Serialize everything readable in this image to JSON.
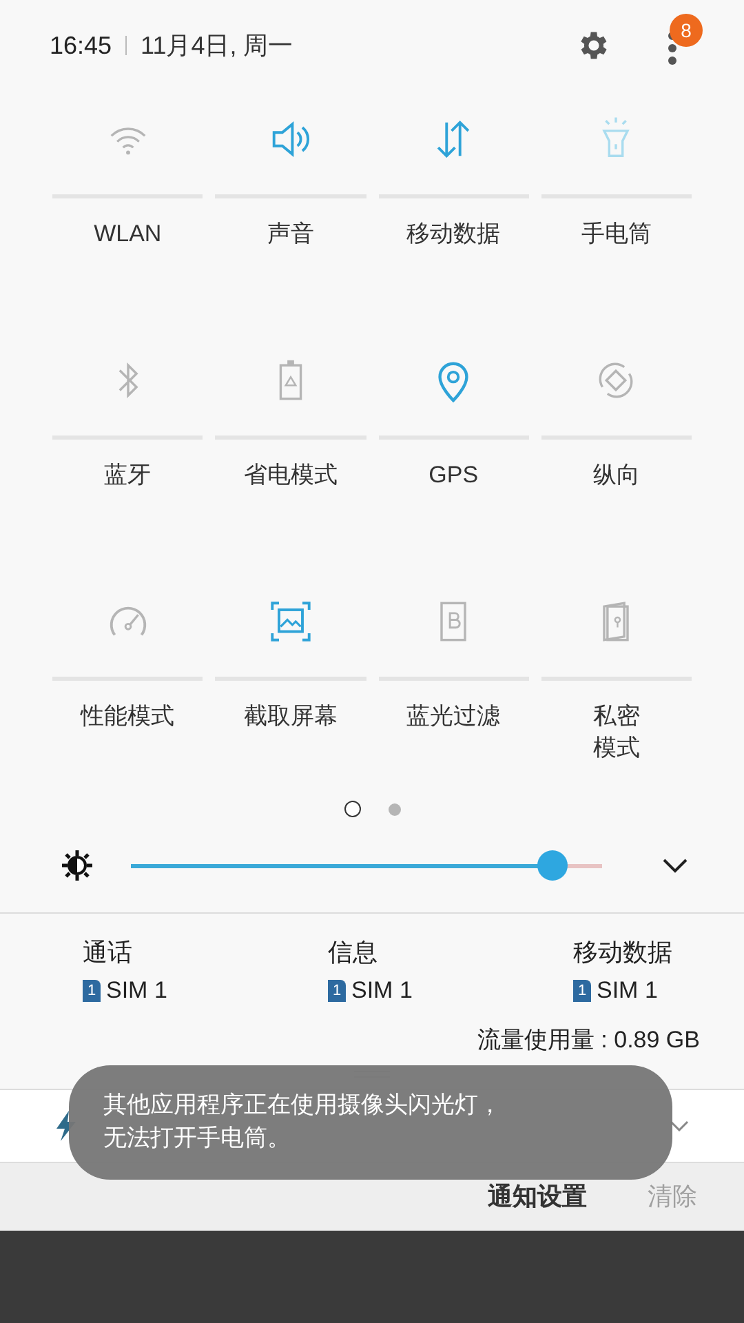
{
  "header": {
    "time": "16:45",
    "date": "11月4日, 周一",
    "badge": "8"
  },
  "tiles": [
    {
      "lines": [
        "WLAN"
      ],
      "on": false,
      "disabled": false
    },
    {
      "lines": [
        "声音"
      ],
      "on": true,
      "disabled": false
    },
    {
      "lines": [
        "移动数据"
      ],
      "on": true,
      "disabled": false
    },
    {
      "lines": [
        "手电筒"
      ],
      "on": true,
      "disabled": true
    },
    {
      "lines": [
        "蓝牙"
      ],
      "on": false,
      "disabled": false
    },
    {
      "lines": [
        "省电模式"
      ],
      "on": false,
      "disabled": false
    },
    {
      "lines": [
        "GPS"
      ],
      "on": true,
      "disabled": false
    },
    {
      "lines": [
        "纵向"
      ],
      "on": false,
      "disabled": false
    },
    {
      "lines": [
        "性能模式"
      ],
      "on": false,
      "disabled": false
    },
    {
      "lines": [
        "截取屏幕"
      ],
      "on": true,
      "disabled": false
    },
    {
      "lines": [
        "蓝光过滤"
      ],
      "on": false,
      "disabled": false
    },
    {
      "lines": [
        "私密",
        "模式"
      ],
      "on": false,
      "disabled": false
    }
  ],
  "pages": [
    {
      "selected": true
    },
    {
      "selected": false
    }
  ],
  "brightness": {
    "level": 0.895
  },
  "sim": [
    {
      "label": "通话",
      "sim": "1",
      "name": "SIM 1"
    },
    {
      "label": "信息",
      "sim": "1",
      "name": "SIM 1"
    },
    {
      "label": "移动数据",
      "sim": "1",
      "name": "SIM 1"
    }
  ],
  "usage": "流量使用量 : 0.89 GB",
  "actions": [
    {
      "label": "通知设置",
      "disabled": false
    },
    {
      "label": "清除",
      "disabled": true
    }
  ],
  "toast": "其他应用程序正在使用摄像头闪光灯，无法打开手电筒。"
}
